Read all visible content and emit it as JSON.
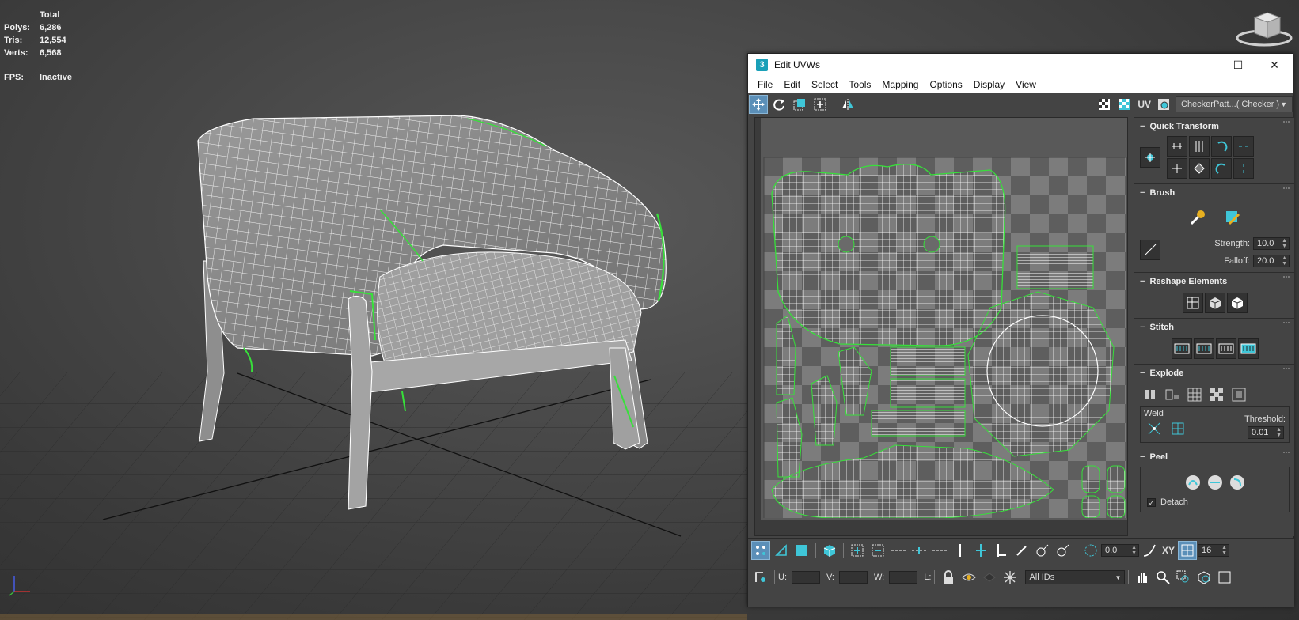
{
  "viewport": {
    "stats": {
      "header": "Total",
      "rows": [
        {
          "label": "Polys:",
          "value": "6,286"
        },
        {
          "label": "Tris:",
          "value": "12,554"
        },
        {
          "label": "Verts:",
          "value": "6,568"
        }
      ],
      "fps_label": "FPS:",
      "fps_value": "Inactive"
    },
    "colors": {
      "seam": "#37e03a",
      "wire": "#ffffff",
      "grid": "#262626"
    }
  },
  "dialog": {
    "app_icon": "3",
    "title": "Edit UVWs",
    "window_buttons": {
      "minimize": "—",
      "maximize": "☐",
      "close": "✕"
    },
    "menu": [
      "File",
      "Edit",
      "Select",
      "Tools",
      "Mapping",
      "Options",
      "Display",
      "View"
    ],
    "toolbar": {
      "uv_label": "UV",
      "texture_select": "CheckerPatt...( Checker )"
    },
    "rollouts": {
      "quick_transform": {
        "title": "Quick Transform"
      },
      "brush": {
        "title": "Brush",
        "strength_label": "Strength:",
        "strength_value": "10.0",
        "falloff_label": "Falloff:",
        "falloff_value": "20.0"
      },
      "reshape": {
        "title": "Reshape Elements"
      },
      "stitch": {
        "title": "Stitch"
      },
      "explode": {
        "title": "Explode",
        "weld_label": "Weld",
        "threshold_label": "Threshold:",
        "threshold_value": "0.01"
      },
      "peel": {
        "title": "Peel",
        "detach_label": "Detach",
        "detach_checked": true
      }
    },
    "bottom": {
      "angle_value": "0.0",
      "xy_label": "XY",
      "snap_value": "16",
      "u_label": "U:",
      "v_label": "V:",
      "w_label": "W:",
      "l_label": "L:",
      "ids_select": "All IDs"
    },
    "colors": {
      "accent": "#3fc6d8",
      "active_button": "#5b8fb8",
      "seam": "#37e03a"
    }
  }
}
